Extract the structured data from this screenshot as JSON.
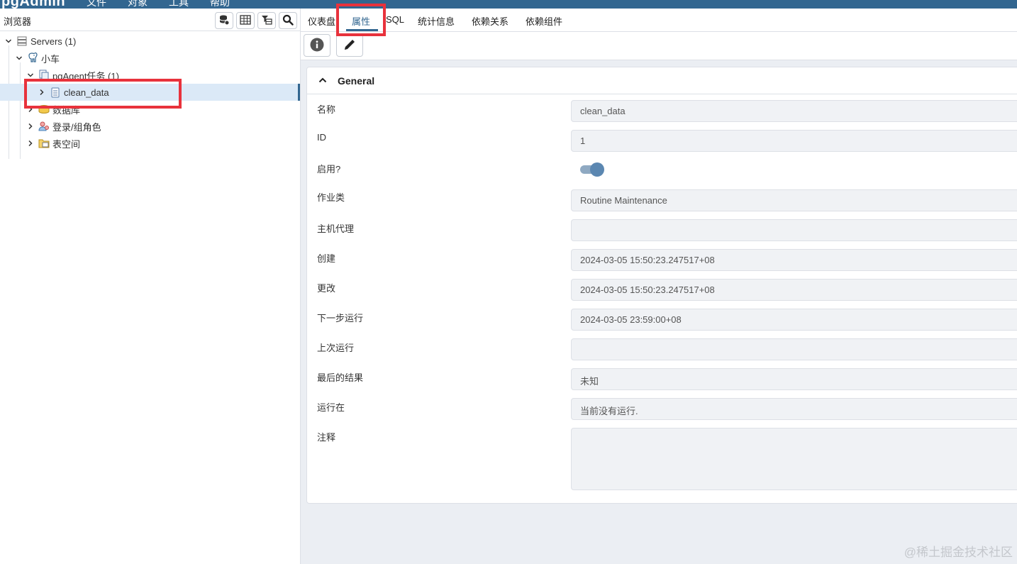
{
  "app": {
    "logo": "pgAdmin",
    "menu": [
      "文件",
      "对象",
      "工具",
      "帮助"
    ]
  },
  "browser": {
    "title": "浏览器",
    "toolbar_icons": [
      "database-query-icon",
      "table-view-icon",
      "filter-table-icon",
      "search-icon"
    ],
    "tree": [
      {
        "label": "Servers (1)",
        "icon": "servers-icon",
        "expanded": true
      },
      {
        "label": "小车",
        "icon": "postgres-elephant-icon",
        "expanded": true
      },
      {
        "label": "pgAgent任务 (1)",
        "icon": "pgagent-jobs-icon",
        "expanded": true
      },
      {
        "label": "clean_data",
        "icon": "job-icon",
        "expanded": false,
        "selected": true
      },
      {
        "label": "数据库",
        "icon": "databases-icon",
        "expanded": false
      },
      {
        "label": "登录/组角色",
        "icon": "roles-icon",
        "expanded": false
      },
      {
        "label": "表空间",
        "icon": "tablespaces-icon",
        "expanded": false
      }
    ]
  },
  "tabs": [
    {
      "label": "仪表盘"
    },
    {
      "label": "属性",
      "active": true
    },
    {
      "label": "SQL"
    },
    {
      "label": "统计信息"
    },
    {
      "label": "依赖关系"
    },
    {
      "label": "依赖组件"
    }
  ],
  "toolbar": {
    "buttons": [
      "info-icon",
      "edit-pencil-icon"
    ]
  },
  "properties": {
    "section_title": "General",
    "fields": [
      {
        "label": "名称",
        "value": "clean_data",
        "type": "text"
      },
      {
        "label": "ID",
        "value": "1",
        "type": "text"
      },
      {
        "label": "启用?",
        "value": "true",
        "type": "toggle"
      },
      {
        "label": "作业类",
        "value": "Routine Maintenance",
        "type": "text"
      },
      {
        "label": "主机代理",
        "value": "",
        "type": "text"
      },
      {
        "label": "创建",
        "value": "2024-03-05 15:50:23.247517+08",
        "type": "text"
      },
      {
        "label": "更改",
        "value": "2024-03-05 15:50:23.247517+08",
        "type": "text"
      },
      {
        "label": "下一步运行",
        "value": "2024-03-05 23:59:00+08",
        "type": "text"
      },
      {
        "label": "上次运行",
        "value": "",
        "type": "text"
      },
      {
        "label": "最后的结果",
        "value": "未知",
        "type": "text"
      },
      {
        "label": "运行在",
        "value": "当前没有运行.",
        "type": "text"
      },
      {
        "label": "注释",
        "value": "",
        "type": "textarea"
      }
    ]
  },
  "colors": {
    "accent": "#326690",
    "highlight_annotation": "#e8323c",
    "selected_row": "#dbe9f7"
  },
  "watermark": "@稀土掘金技术社区"
}
